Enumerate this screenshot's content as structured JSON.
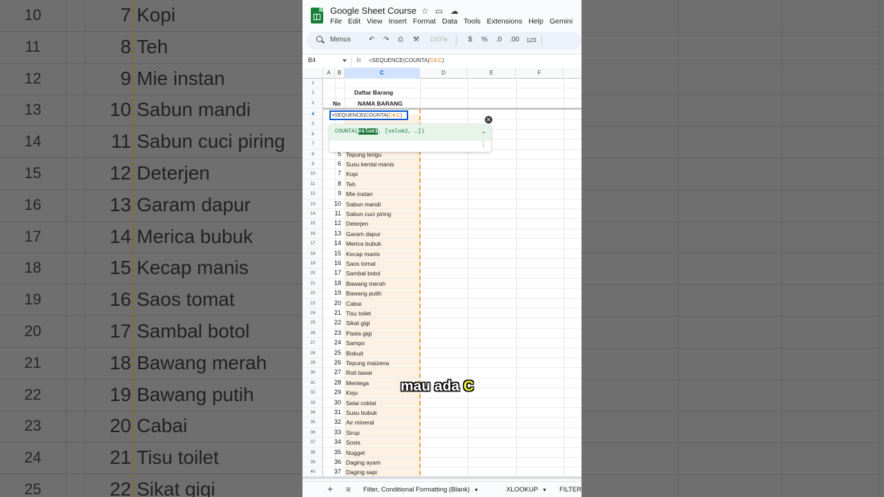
{
  "doc": {
    "title": "Google Sheet Course"
  },
  "menu": [
    "File",
    "Edit",
    "View",
    "Insert",
    "Format",
    "Data",
    "Tools",
    "Extensions",
    "Help",
    "Gemini"
  ],
  "toolbar": {
    "search_label": "Menus",
    "zoom": "100%",
    "currency": "$",
    "percent": "%",
    "dec_decrease": ".0",
    "dec_increase": ".00",
    "number_format": "123"
  },
  "formula_bar": {
    "cell_ref": "B4",
    "fx": "fx",
    "formula_prefix": "=SEQUENCE(COUNTA(",
    "formula_ref": "C4:C",
    "formula_suffix": ")"
  },
  "columns": [
    "A",
    "B",
    "C",
    "D",
    "E",
    "F"
  ],
  "sheet": {
    "title_cell": "Daftar Barang",
    "header_no": "No",
    "header_name": "NAMA BARANG",
    "editing_cell": {
      "prefix": "=SEQUENCE(COUNTA(",
      "ref": "C4:C",
      "suffix": ")"
    },
    "items": [
      {
        "row": "8",
        "no": "5",
        "name": "Tepung terigu"
      },
      {
        "row": "9",
        "no": "6",
        "name": "Susu kental manis"
      },
      {
        "row": "10",
        "no": "7",
        "name": "Kopi"
      },
      {
        "row": "11",
        "no": "8",
        "name": "Teh"
      },
      {
        "row": "12",
        "no": "9",
        "name": "Mie instan"
      },
      {
        "row": "13",
        "no": "10",
        "name": "Sabun mandi"
      },
      {
        "row": "14",
        "no": "11",
        "name": "Sabun cuci piring"
      },
      {
        "row": "15",
        "no": "12",
        "name": "Deterjen"
      },
      {
        "row": "16",
        "no": "13",
        "name": "Garam dapur"
      },
      {
        "row": "17",
        "no": "14",
        "name": "Merica bubuk"
      },
      {
        "row": "18",
        "no": "15",
        "name": "Kecap manis"
      },
      {
        "row": "19",
        "no": "16",
        "name": "Saos tomat"
      },
      {
        "row": "20",
        "no": "17",
        "name": "Sambal botol"
      },
      {
        "row": "21",
        "no": "18",
        "name": "Bawang merah"
      },
      {
        "row": "22",
        "no": "19",
        "name": "Bawang putih"
      },
      {
        "row": "23",
        "no": "20",
        "name": "Cabai"
      },
      {
        "row": "24",
        "no": "21",
        "name": "Tisu toilet"
      },
      {
        "row": "25",
        "no": "22",
        "name": "Sikat gigi"
      },
      {
        "row": "26",
        "no": "23",
        "name": "Pasta gigi"
      },
      {
        "row": "27",
        "no": "24",
        "name": "Sampo"
      },
      {
        "row": "28",
        "no": "25",
        "name": "Biskuit"
      },
      {
        "row": "29",
        "no": "26",
        "name": "Tepung maizena"
      },
      {
        "row": "30",
        "no": "27",
        "name": "Roti tawar"
      },
      {
        "row": "31",
        "no": "28",
        "name": "Mentega"
      },
      {
        "row": "32",
        "no": "29",
        "name": "Keju"
      },
      {
        "row": "33",
        "no": "30",
        "name": "Selai coklat"
      },
      {
        "row": "34",
        "no": "31",
        "name": "Susu bubuk"
      },
      {
        "row": "35",
        "no": "32",
        "name": "Air mineral"
      },
      {
        "row": "36",
        "no": "33",
        "name": "Sirup"
      },
      {
        "row": "37",
        "no": "34",
        "name": "Sosis"
      },
      {
        "row": "38",
        "no": "35",
        "name": "Nugget"
      },
      {
        "row": "39",
        "no": "36",
        "name": "Daging ayam"
      },
      {
        "row": "40",
        "no": "37",
        "name": "Daging sapi"
      }
    ]
  },
  "autocomplete": {
    "fn": "COUNTA(",
    "arg1": "value1",
    "rest": ", [value2, …])"
  },
  "tabs": [
    {
      "label": "Filter, Conditional Formatting (Blank)"
    },
    {
      "label": "XLOOKUP"
    },
    {
      "label": "FILTER"
    }
  ],
  "caption": {
    "text": "mau ada ",
    "highlight": "C"
  },
  "background": {
    "rows": [
      {
        "rn": "10",
        "no": "7",
        "name": "Kopi"
      },
      {
        "rn": "11",
        "no": "8",
        "name": "Teh"
      },
      {
        "rn": "12",
        "no": "9",
        "name": "Mie instan"
      },
      {
        "rn": "13",
        "no": "10",
        "name": "Sabun mandi"
      },
      {
        "rn": "14",
        "no": "11",
        "name": "Sabun cuci piring"
      },
      {
        "rn": "15",
        "no": "12",
        "name": "Deterjen"
      },
      {
        "rn": "16",
        "no": "13",
        "name": "Garam dapur"
      },
      {
        "rn": "17",
        "no": "14",
        "name": "Merica bubuk"
      },
      {
        "rn": "18",
        "no": "15",
        "name": "Kecap manis"
      },
      {
        "rn": "19",
        "no": "16",
        "name": "Saos tomat"
      },
      {
        "rn": "20",
        "no": "17",
        "name": "Sambal botol"
      },
      {
        "rn": "21",
        "no": "18",
        "name": "Bawang merah"
      },
      {
        "rn": "22",
        "no": "19",
        "name": "Bawang putih"
      },
      {
        "rn": "23",
        "no": "20",
        "name": "Cabai"
      },
      {
        "rn": "24",
        "no": "21",
        "name": "Tisu toilet"
      },
      {
        "rn": "25",
        "no": "22",
        "name": "Sikat gigi"
      }
    ]
  }
}
